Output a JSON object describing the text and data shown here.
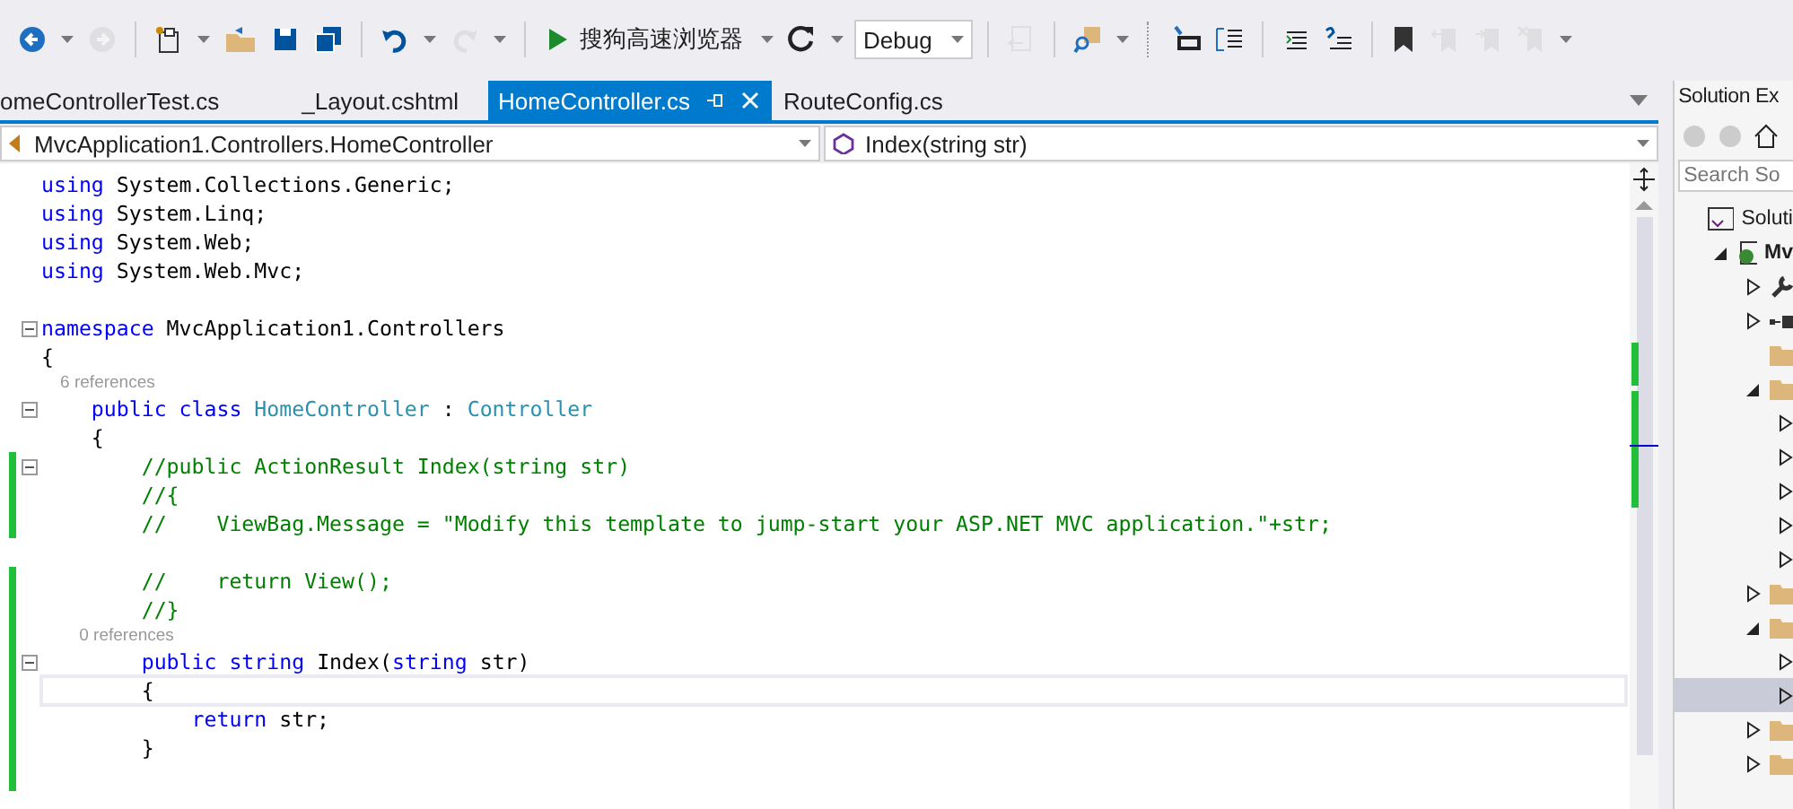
{
  "toolbar": {
    "buttons": [
      {
        "disabled": false
      },
      {
        "disabled": true
      },
      {
        "disabled": false
      },
      {
        "disabled": false
      },
      {
        "disabled": false
      },
      {
        "disabled": false
      },
      {
        "disabled": false
      },
      {
        "disabled": true
      },
      {
        "disabled": false
      },
      {
        "disabled": true
      },
      {
        "disabled": false
      },
      {
        "disabled": false
      },
      {
        "disabled": false
      },
      {
        "disabled": false
      },
      {
        "disabled": false
      },
      {
        "disabled": false
      },
      {
        "disabled": true
      },
      {
        "disabled": true
      },
      {
        "disabled": true
      }
    ],
    "run_target": "搜狗高速浏览器",
    "configuration": "Debug"
  },
  "tabs": [
    {
      "label": "omeControllerTest.cs",
      "selected": false
    },
    {
      "label": "_Layout.cshtml",
      "selected": false
    },
    {
      "label": "HomeController.cs",
      "selected": true
    },
    {
      "label": "RouteConfig.cs",
      "selected": false
    }
  ],
  "navigation": {
    "type": "MvcApplication1.Controllers.HomeController",
    "member": "Index(string str)"
  },
  "editor": {
    "lines": [
      {
        "kind": "code",
        "fold": false,
        "changed": false,
        "current": false,
        "tokens": [
          {
            "kind": "keyword",
            "text": "using"
          },
          {
            "kind": "plain",
            "text": " System.Collections.Generic;"
          }
        ]
      },
      {
        "kind": "code",
        "fold": false,
        "changed": false,
        "current": false,
        "tokens": [
          {
            "kind": "keyword",
            "text": "using"
          },
          {
            "kind": "plain",
            "text": " System.Linq;"
          }
        ]
      },
      {
        "kind": "code",
        "fold": false,
        "changed": false,
        "current": false,
        "tokens": [
          {
            "kind": "keyword",
            "text": "using"
          },
          {
            "kind": "plain",
            "text": " System.Web;"
          }
        ]
      },
      {
        "kind": "code",
        "fold": false,
        "changed": false,
        "current": false,
        "tokens": [
          {
            "kind": "keyword",
            "text": "using"
          },
          {
            "kind": "plain",
            "text": " System.Web.Mvc;"
          }
        ]
      },
      {
        "kind": "blank",
        "changed": false
      },
      {
        "kind": "code",
        "fold": true,
        "changed": false,
        "current": false,
        "tokens": [
          {
            "kind": "keyword",
            "text": "namespace"
          },
          {
            "kind": "plain",
            "text": " MvcApplication1.Controllers"
          }
        ]
      },
      {
        "kind": "code",
        "fold": false,
        "changed": false,
        "current": false,
        "tokens": [
          {
            "kind": "plain",
            "text": "{"
          }
        ]
      },
      {
        "kind": "codelens",
        "changed": false,
        "text": "    6 references"
      },
      {
        "kind": "code",
        "fold": true,
        "changed": false,
        "current": false,
        "tokens": [
          {
            "kind": "keyword",
            "text": "    public class"
          },
          {
            "kind": "type",
            "text": " HomeController"
          },
          {
            "kind": "plain",
            "text": " : "
          },
          {
            "kind": "type",
            "text": "Controller"
          }
        ]
      },
      {
        "kind": "code",
        "fold": false,
        "changed": false,
        "current": false,
        "tokens": [
          {
            "kind": "plain",
            "text": "    {"
          }
        ]
      },
      {
        "kind": "code",
        "fold": true,
        "changed": true,
        "current": false,
        "tokens": [
          {
            "kind": "comment",
            "text": "        //public ActionResult Index(string str)"
          }
        ]
      },
      {
        "kind": "code",
        "fold": false,
        "changed": true,
        "current": false,
        "tokens": [
          {
            "kind": "comment",
            "text": "        //{"
          }
        ]
      },
      {
        "kind": "code",
        "fold": false,
        "changed": true,
        "current": false,
        "tokens": [
          {
            "kind": "comment",
            "text": "        //    ViewBag.Message = \"Modify this template to jump-start your ASP.NET MVC application.\"+str;"
          }
        ]
      },
      {
        "kind": "blank",
        "changed": false
      },
      {
        "kind": "code",
        "fold": false,
        "changed": true,
        "current": false,
        "tokens": [
          {
            "kind": "comment",
            "text": "        //    return View();"
          }
        ]
      },
      {
        "kind": "code",
        "fold": false,
        "changed": true,
        "current": false,
        "tokens": [
          {
            "kind": "comment",
            "text": "        //}"
          }
        ]
      },
      {
        "kind": "codelens",
        "changed": true,
        "text": "        0 references"
      },
      {
        "kind": "code",
        "fold": true,
        "changed": true,
        "current": false,
        "tokens": [
          {
            "kind": "keyword",
            "text": "        public string"
          },
          {
            "kind": "plain",
            "text": " Index("
          },
          {
            "kind": "keyword",
            "text": "string"
          },
          {
            "kind": "plain",
            "text": " str)"
          }
        ]
      },
      {
        "kind": "code",
        "fold": false,
        "changed": true,
        "current": true,
        "tokens": [
          {
            "kind": "plain",
            "text": "        {"
          }
        ]
      },
      {
        "kind": "code",
        "fold": false,
        "changed": true,
        "current": false,
        "tokens": [
          {
            "kind": "keyword",
            "text": "            return"
          },
          {
            "kind": "plain",
            "text": " str;"
          }
        ]
      },
      {
        "kind": "code",
        "fold": false,
        "changed": true,
        "current": false,
        "tokens": [
          {
            "kind": "plain",
            "text": "        }"
          }
        ]
      },
      {
        "kind": "blank",
        "changed": true
      }
    ]
  },
  "solution_explorer": {
    "title": "Solution Ex",
    "search": {
      "placeholder": "Search So"
    },
    "tree": [
      {
        "kind": "solution",
        "label": "Soluti",
        "selected": false,
        "children": [
          {
            "kind": "web-project",
            "label": "Mv",
            "expanded": true,
            "selected": false,
            "children": [
              {
                "kind": "properties",
                "expanded": false,
                "selected": false
              },
              {
                "kind": "references",
                "expanded": false,
                "selected": false
              },
              {
                "kind": "folder",
                "selected": false
              },
              {
                "kind": "folder",
                "expanded": true,
                "selected": false,
                "children": [
                  {
                    "expanded": false,
                    "selected": false
                  },
                  {
                    "expanded": false,
                    "selected": false
                  },
                  {
                    "expanded": false,
                    "selected": false
                  },
                  {
                    "expanded": false,
                    "selected": false
                  },
                  {
                    "expanded": false,
                    "selected": false
                  }
                ]
              },
              {
                "kind": "folder",
                "expanded": false,
                "selected": false
              },
              {
                "kind": "folder",
                "expanded": true,
                "selected": false,
                "children": [
                  {
                    "expanded": false,
                    "selected": false
                  },
                  {
                    "expanded": false,
                    "selected": true
                  }
                ]
              },
              {
                "kind": "folder",
                "expanded": false,
                "selected": false
              },
              {
                "kind": "folder",
                "expanded": false,
                "selected": false
              }
            ]
          }
        ]
      }
    ]
  }
}
